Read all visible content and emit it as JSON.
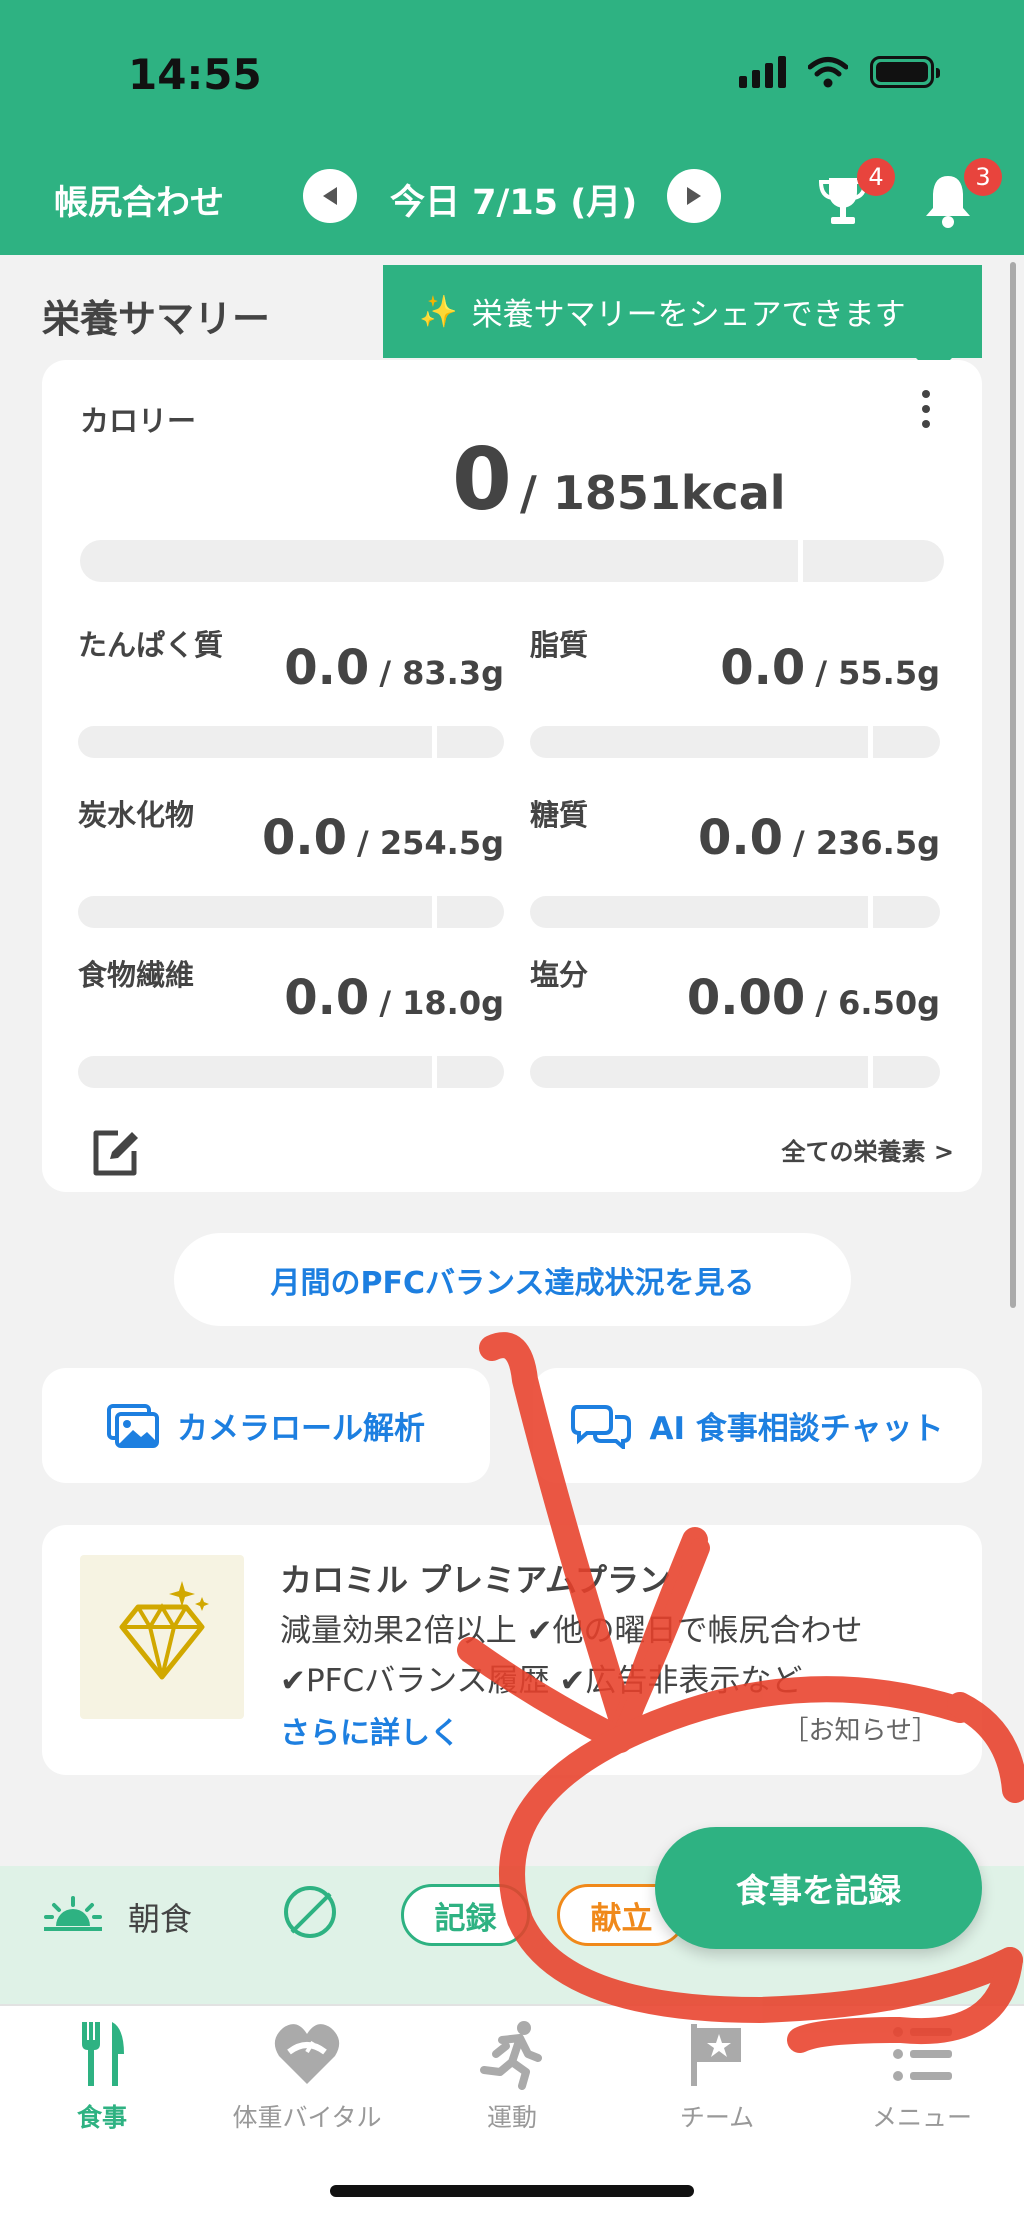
{
  "status_bar": {
    "time": "14:55"
  },
  "nav": {
    "left_label": "帳尻合わせ",
    "date_label": "今日 7/15 (月)",
    "trophy_badge": "4",
    "bell_badge": "3"
  },
  "summary": {
    "title": "栄養サマリー",
    "share_tip": "栄養サマリーをシェアできます",
    "calorie_label": "カロリー",
    "calorie_value": "0",
    "calorie_target": "/ 1851kcal",
    "nutrients": [
      {
        "label": "たんぱく質",
        "value": "0.0",
        "target": "/ 83.3g"
      },
      {
        "label": "脂質",
        "value": "0.0",
        "target": "/ 55.5g"
      },
      {
        "label": "炭水化物",
        "value": "0.0",
        "target": "/ 254.5g"
      },
      {
        "label": "糖質",
        "value": "0.0",
        "target": "/ 236.5g"
      },
      {
        "label": "食物繊維",
        "value": "0.0",
        "target": "/ 18.0g"
      },
      {
        "label": "塩分",
        "value": "0.00",
        "target": "/ 6.50g"
      }
    ],
    "all_nutrients_link": "全ての栄養素 >"
  },
  "pfc_button": "月間のPFCバランス達成状況を見る",
  "actions": {
    "camera_roll": "カメラロール解析",
    "ai_chat": "AI 食事相談チャット"
  },
  "premium": {
    "title": "カロミル プレミアムプラン",
    "line1": "減量効果2倍以上 ✔他の曜日で帳尻合わせ",
    "line2": "✔PFCバランス履歴 ✔広告非表示など",
    "more": "さらに詳しく",
    "notice": "［お知らせ］"
  },
  "meals": {
    "breakfast": "朝食",
    "record": "記録",
    "menu": "献立"
  },
  "fab": "食事を記録",
  "tabs": [
    {
      "label": "食事",
      "icon": "fork-knife-icon"
    },
    {
      "label": "体重バイタル",
      "icon": "heart-scale-icon"
    },
    {
      "label": "運動",
      "icon": "runner-icon"
    },
    {
      "label": "チーム",
      "icon": "flag-icon"
    },
    {
      "label": "メニュー",
      "icon": "menu-list-icon"
    }
  ],
  "colors": {
    "brand_green": "#2eb282",
    "link_blue": "#1d7fe0",
    "badge_red": "#e8443d",
    "menu_orange": "#f0891a",
    "annotation_red": "#e8402a"
  }
}
